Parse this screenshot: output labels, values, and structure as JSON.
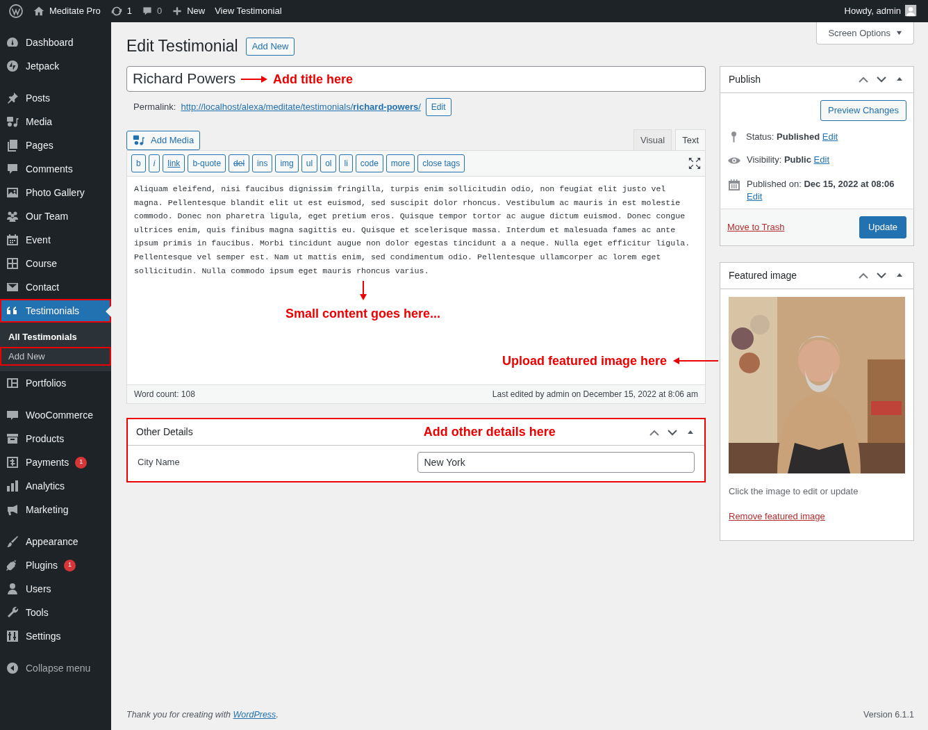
{
  "admin_bar": {
    "site": "Meditate Pro",
    "updates": "1",
    "comments": "0",
    "new": "New",
    "view": "View Testimonial",
    "howdy": "Howdy, admin"
  },
  "sidebar": {
    "groups": [
      [
        {
          "label": "Dashboard",
          "selected": false,
          "outlined": false
        },
        {
          "label": "Jetpack",
          "selected": false,
          "outlined": false
        }
      ],
      [
        {
          "label": "Posts",
          "selected": false,
          "outlined": false
        },
        {
          "label": "Media",
          "selected": false,
          "outlined": false
        },
        {
          "label": "Pages",
          "selected": false,
          "outlined": false
        },
        {
          "label": "Comments",
          "selected": false,
          "outlined": false
        },
        {
          "label": "Photo Gallery",
          "selected": false,
          "outlined": false
        },
        {
          "label": "Our Team",
          "selected": false,
          "outlined": false
        },
        {
          "label": "Event",
          "selected": false,
          "outlined": false
        },
        {
          "label": "Course",
          "selected": false,
          "outlined": false
        },
        {
          "label": "Contact",
          "selected": false,
          "outlined": false
        },
        {
          "label": "Testimonials",
          "selected": true,
          "outlined": true,
          "children": [
            {
              "label": "All Testimonials",
              "selected": true,
              "outlined": false
            },
            {
              "label": "Add New",
              "selected": false,
              "outlined": true
            }
          ]
        },
        {
          "label": "Portfolios",
          "selected": false,
          "outlined": false
        }
      ],
      [
        {
          "label": "WooCommerce",
          "selected": false,
          "outlined": false
        },
        {
          "label": "Products",
          "selected": false,
          "outlined": false
        },
        {
          "label": "Payments",
          "selected": false,
          "outlined": false,
          "badge": "1"
        },
        {
          "label": "Analytics",
          "selected": false,
          "outlined": false
        },
        {
          "label": "Marketing",
          "selected": false,
          "outlined": false
        }
      ],
      [
        {
          "label": "Appearance",
          "selected": false,
          "outlined": false
        },
        {
          "label": "Plugins",
          "selected": false,
          "outlined": false,
          "badge": "1"
        },
        {
          "label": "Users",
          "selected": false,
          "outlined": false
        },
        {
          "label": "Tools",
          "selected": false,
          "outlined": false
        },
        {
          "label": "Settings",
          "selected": false,
          "outlined": false
        }
      ]
    ],
    "collapse": "Collapse menu"
  },
  "screen_options": "Screen Options",
  "page_title": "Edit Testimonial",
  "add_new": "Add New",
  "title_field": {
    "value": "Richard Powers",
    "annotation": "Add title here"
  },
  "permalink": {
    "label": "Permalink:",
    "url": "http://localhost/alexa/meditate/testimonials/**richard-powers**/",
    "edit": "Edit"
  },
  "editor": {
    "add_media": "Add Media",
    "tabs": [
      {
        "label": "Visual",
        "selected": false
      },
      {
        "label": "Text",
        "selected": true
      }
    ],
    "quicktags": [
      {
        "label": "b",
        "kind": "plain"
      },
      {
        "label": "i",
        "kind": "italic"
      },
      {
        "label": "link",
        "kind": "underline"
      },
      {
        "label": "b-quote",
        "kind": "plain"
      },
      {
        "label": "del",
        "kind": "strike"
      },
      {
        "label": "ins",
        "kind": "plain"
      },
      {
        "label": "img",
        "kind": "plain"
      },
      {
        "label": "ul",
        "kind": "plain"
      },
      {
        "label": "ol",
        "kind": "plain"
      },
      {
        "label": "li",
        "kind": "plain"
      },
      {
        "label": "code",
        "kind": "plain"
      },
      {
        "label": "more",
        "kind": "plain"
      },
      {
        "label": "close tags",
        "kind": "plain"
      }
    ],
    "content": "Aliquam eleifend, nisi faucibus dignissim fringilla, turpis enim sollicitudin odio, non feugiat elit justo vel magna. Pellentesque blandit elit ut est euismod, sed suscipit dolor rhoncus. Vestibulum ac mauris in est molestie commodo. Donec non pharetra ligula, eget pretium eros. Quisque tempor tortor ac augue dictum euismod. Donec congue ultrices enim, quis finibus magna sagittis eu. Quisque et scelerisque massa. Interdum et malesuada fames ac ante ipsum primis in faucibus. Morbi tincidunt augue non dolor egestas tincidunt a a neque. Nulla eget efficitur ligula. Pellentesque vel semper est. Nam ut mattis enim, sed condimentum odio. Pellentesque ullamcorper ac lorem eget sollicitudin. Nulla commodo ipsum eget mauris rhoncus varius.",
    "annotation": "Small content goes here...",
    "word_count": "Word count: 108",
    "last_edited": "Last edited by admin on December 15, 2022 at 8:06 am"
  },
  "other_details": {
    "title": "Other Details",
    "annotation": "Add other details here",
    "outlined": true,
    "fields": [
      {
        "label": "City Name",
        "value": "New York"
      }
    ]
  },
  "publish": {
    "title": "Publish",
    "preview": "Preview Changes",
    "rows": [
      {
        "text": "Status: **Published**",
        "edit": "Edit"
      },
      {
        "text": "Visibility: **Public**",
        "edit": "Edit"
      },
      {
        "text": "Published on: **Dec 15, 2022 at 08:06**",
        "edit": "Edit"
      }
    ],
    "trash": "Move to Trash",
    "update": "Update"
  },
  "featured_image": {
    "title": "Featured image",
    "caption": "Click the image to edit or update",
    "remove": "Remove featured image",
    "annotation": "Upload featured image here"
  },
  "footer": {
    "before": "Thank you for creating with ",
    "link": "WordPress",
    "after": ".",
    "version": "Version 6.1.1"
  }
}
